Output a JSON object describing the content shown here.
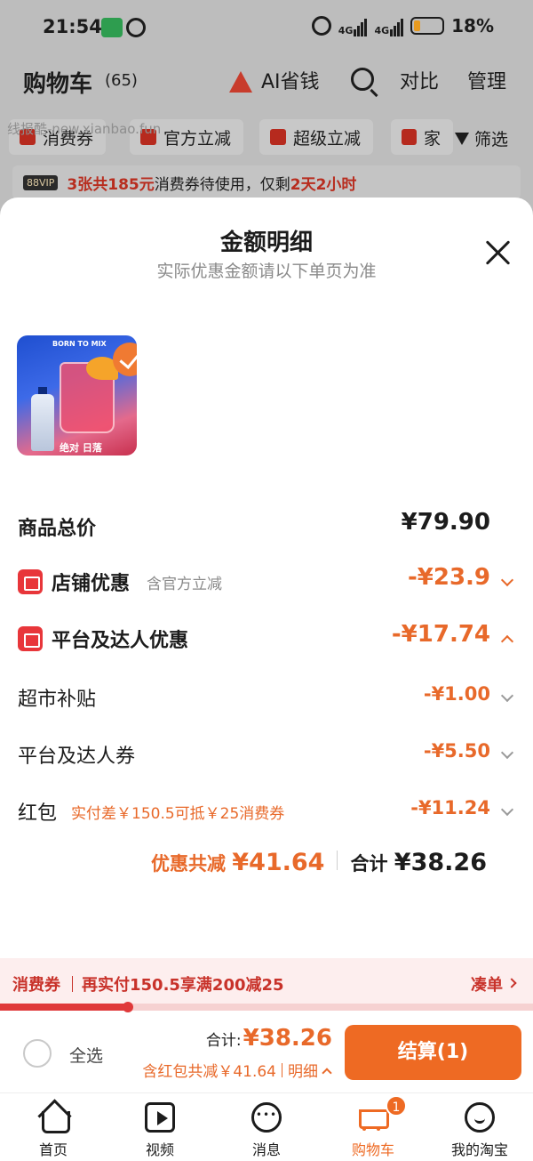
{
  "status_bar": {
    "time": "21:54",
    "battery_pct": "18%",
    "network": "4G",
    "battery_level": 0.18
  },
  "header": {
    "title": "购物车",
    "count": "(65)",
    "ai_label": "AI省钱",
    "compare_label": "对比",
    "manage_label": "管理",
    "watermark": "线报酷-new.xianbao.fun"
  },
  "filters": {
    "chips": [
      "消费券",
      "官方立减",
      "超级立减",
      "家"
    ],
    "filter_label": "筛选"
  },
  "vip_bar": {
    "badge": "88VIP",
    "count_text": "3张共185元",
    "mid_text": "消费券待使用，仅剩",
    "time_left": "2天2小时"
  },
  "sheet": {
    "title": "金额明细",
    "subtitle": "实际优惠金额请以下单页为准",
    "product": {
      "tag": "BORN TO MIX",
      "caption": "绝对 日落"
    },
    "rows": {
      "total": {
        "label": "商品总价",
        "amount": "¥79.90"
      },
      "store": {
        "label": "店铺优惠",
        "note": "含官方立减",
        "amount": "-¥23.9"
      },
      "platform": {
        "label": "平台及达人优惠",
        "amount": "-¥17.74"
      },
      "supermarket": {
        "label": "超市补贴",
        "amount": "-¥1.00"
      },
      "coupon": {
        "label": "平台及达人券",
        "amount": "-¥5.50"
      },
      "redpacket": {
        "label": "红包",
        "note": "实付差￥150.5可抵￥25消费券",
        "amount": "-¥11.24"
      }
    },
    "summary": {
      "discount_label": "优惠共减 ",
      "discount_amount": "¥41.64",
      "total_label": "合计 ",
      "total_amount": "¥38.26"
    }
  },
  "coupon_bar": {
    "label": "消费券",
    "text": "再实付150.5享满200减25",
    "action": "凑单",
    "progress": 0.24
  },
  "checkout": {
    "select_all": "全选",
    "total_label": "合计:",
    "total_amount": "¥38.26",
    "discount_text": "含红包共减￥41.64",
    "detail_label": "明细",
    "button_label": "结算(1)"
  },
  "tabbar": {
    "tabs": [
      "首页",
      "视频",
      "消息",
      "购物车",
      "我的淘宝"
    ],
    "cart_badge": "1"
  },
  "colors": {
    "accent": "#ee6a23",
    "discount": "#e8692a",
    "coupon_red": "#c8322a"
  }
}
